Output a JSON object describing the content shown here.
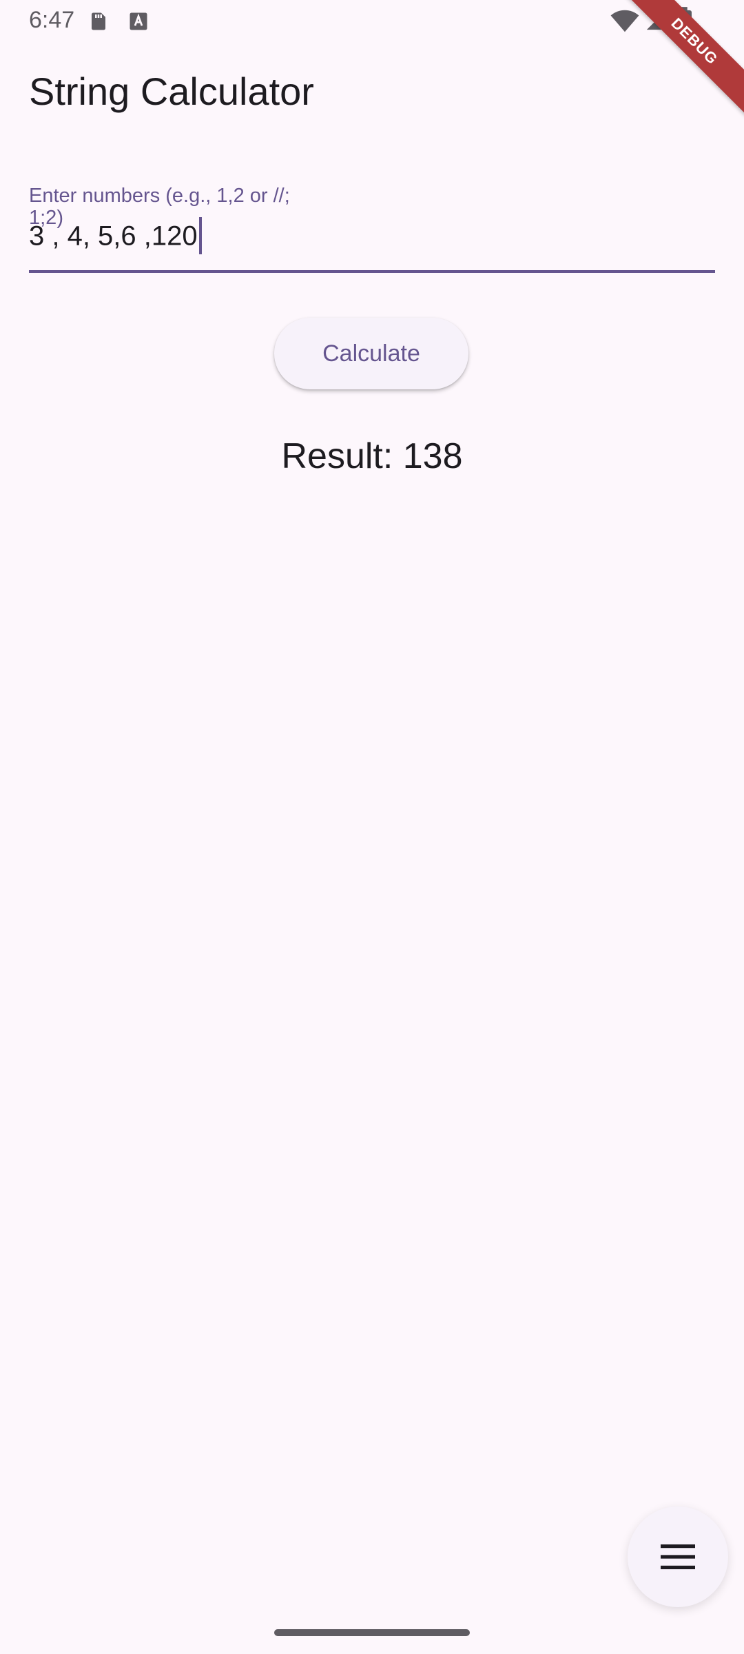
{
  "status_bar": {
    "time": "6:47",
    "icons": [
      "sd-card-icon",
      "a-keyboard-icon",
      "wifi-icon",
      "signal-icon",
      "battery-icon"
    ]
  },
  "debug_banner": "DEBUG",
  "app_bar": {
    "title": "String Calculator"
  },
  "input": {
    "label": "Enter numbers (e.g., 1,2 or //;\n1;2)",
    "value": "3 , 4, 5,6 ,120"
  },
  "calculate_button": {
    "label": "Calculate"
  },
  "result": {
    "text": "Result: 138"
  },
  "fab": {
    "icon": "menu-icon"
  },
  "colors": {
    "background": "#FDF7FC",
    "primary": "#65558F",
    "surface": "#F7F2FA",
    "debug": "#B03A3A"
  }
}
